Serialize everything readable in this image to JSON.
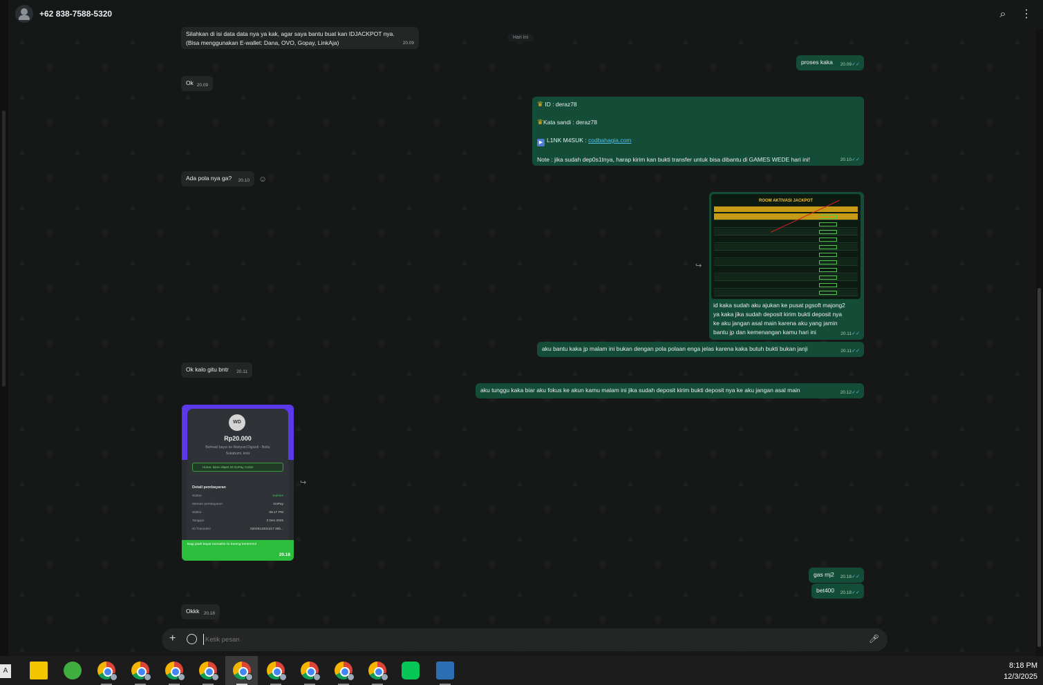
{
  "header": {
    "title": "+62 838-7588-5320"
  },
  "date_chip": "Hari Ini",
  "messages": {
    "m1": {
      "line1": "Silahkan di isi data data nya ya kak, agar saya bantu buat kan IDJACKPOT nya.",
      "line2": "(Bisa menggunakan E-wallet: Dana, OVO, Gopay, LinkAja)",
      "time": "20.09"
    },
    "m2": {
      "text": "proses kaka",
      "time": "20.09"
    },
    "m3": {
      "text": "Ok",
      "time": "20.09"
    },
    "m4": {
      "id_line": "ID : deraz78",
      "pass_line": "Kata sandi : deraz78",
      "link_label": "L1NK M4SUK : ",
      "link_url": "codbahagia.com",
      "note": "Note : jika sudah dep0s1tnya, harap kirim kan bukti transfer untuk bisa dibantu di GAMES WEDE hari ini!",
      "time": "20.10"
    },
    "m5": {
      "text": "Ada pola nya ga?",
      "time": "20.10"
    },
    "m6": {
      "image_title": "ROOM AKTIVASI JACKPOT",
      "l1": "id kaka sudah aku ajukan ke pusat pgsoft majong2",
      "l2": "ya kaka jika sudah deposit kirim bukti deposit nya",
      "l3": "ke aku jangan asal main karena aku yang jamin",
      "l4": "bantu jp dan kemenangan kamu hari ini",
      "time": "20.11"
    },
    "m7": {
      "text": "aku bantu kaka jp malam ini bukan dengan pola polaan enga jelas karena kaka butuh bukti bukan janji",
      "time": "20.11"
    },
    "m8": {
      "text": "Ok kalo gitu bntr",
      "time": "20.11"
    },
    "m9": {
      "text": "aku tunggu kaka biar aku fokus ke akun kamu malam ini jika sudah deposit kirim bukti deposit nya ke aku jangan asal main",
      "time": "20.12"
    },
    "m10": {
      "avatar": "WD",
      "amount": "Rp20.000",
      "line1": "Berhasil bayar ke Wahyuni Digicell - Nobu",
      "line2": "Sukabumi, kota",
      "promo": "Horee, kamu dapet 20 GoPay Coins!",
      "section": "Detail pembayaran",
      "rows": [
        {
          "k": "Status",
          "v": "Sukses"
        },
        {
          "k": "Metode pembayaran",
          "v": "GoPay"
        },
        {
          "k": "Waktu",
          "v": "08.17 PM"
        },
        {
          "k": "Tanggal",
          "v": "3 Des 2025"
        },
        {
          "k": "ID Transaksi",
          "v": "0202512031317 26b..."
        }
      ],
      "footer": "Bagi jatah bayar transaksi ini bareng temenmu!",
      "time": "20.18"
    },
    "m11": {
      "text": "gas mj2",
      "time": "20.18"
    },
    "m12": {
      "text": "bet400",
      "time": "20.18"
    },
    "m13": {
      "text": "Okkk",
      "time": "20.18"
    }
  },
  "composer": {
    "placeholder": "Ketik pesan"
  },
  "taskbar": {
    "time": "8:18 PM",
    "date": "12/3/2025",
    "kbd": "A"
  },
  "icons": [
    "search-icon",
    "menu-icon",
    "plus-icon",
    "emoji-icon",
    "mic-icon",
    "forward-icon",
    "reaction-icon",
    "double-check-icon"
  ],
  "colors": {
    "incoming": "#242626",
    "outgoing": "#144d37",
    "accent": "#53bdeb"
  }
}
